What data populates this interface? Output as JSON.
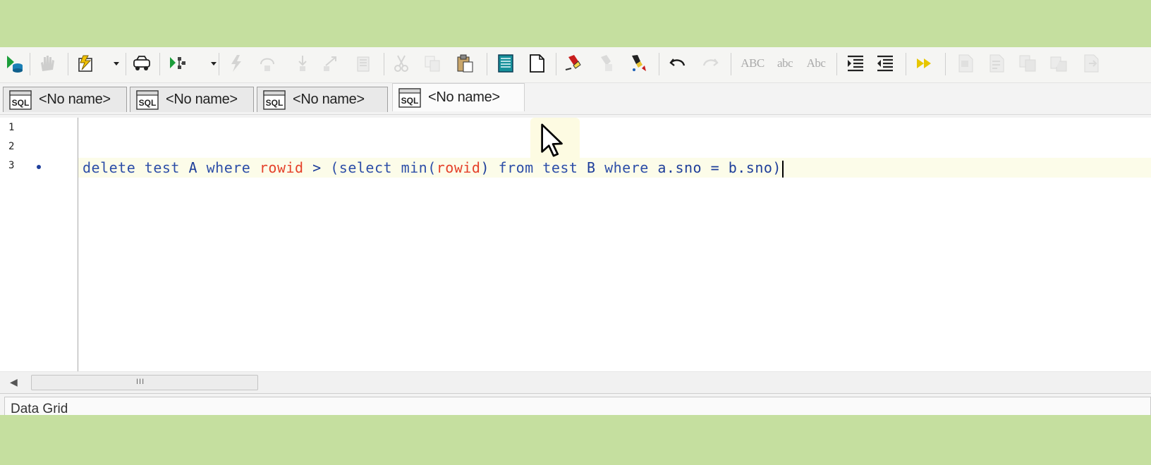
{
  "toolbar": {
    "buttons": [
      {
        "icon": "execute-icon",
        "enabled": true
      },
      {
        "icon": "stop-hand-icon",
        "enabled": false
      },
      {
        "icon": "explain-plan-icon",
        "enabled": true
      },
      {
        "icon": "autotrace-icon",
        "enabled": true
      },
      {
        "icon": "debugger-icon",
        "enabled": true
      },
      {
        "icon": "step-lightning-icon",
        "enabled": false
      },
      {
        "icon": "step-over-icon",
        "enabled": false
      },
      {
        "icon": "step-into-icon",
        "enabled": false
      },
      {
        "icon": "step-out-icon",
        "enabled": false
      },
      {
        "icon": "run-to-cursor-icon",
        "enabled": false
      },
      {
        "icon": "cut-icon",
        "enabled": false
      },
      {
        "icon": "copy-icon",
        "enabled": false
      },
      {
        "icon": "paste-icon",
        "enabled": true
      },
      {
        "icon": "save-document-icon",
        "enabled": true
      },
      {
        "icon": "new-document-icon",
        "enabled": true
      },
      {
        "icon": "highlight-icon",
        "enabled": true
      },
      {
        "icon": "clear-highlight-icon",
        "enabled": false
      },
      {
        "icon": "find-replace-icon",
        "enabled": true
      },
      {
        "icon": "undo-icon",
        "enabled": true
      },
      {
        "icon": "redo-icon",
        "enabled": false
      },
      {
        "icon": "uppercase-icon",
        "enabled": false
      },
      {
        "icon": "lowercase-icon",
        "enabled": false
      },
      {
        "icon": "initcap-icon",
        "enabled": false
      },
      {
        "icon": "indent-icon",
        "enabled": true
      },
      {
        "icon": "unindent-icon",
        "enabled": true
      },
      {
        "icon": "next-bookmark-icon",
        "enabled": true
      },
      {
        "icon": "comment-icon",
        "enabled": false
      },
      {
        "icon": "uncomment-icon",
        "enabled": false
      },
      {
        "icon": "format-icon",
        "enabled": false
      },
      {
        "icon": "copy-block-icon",
        "enabled": false
      },
      {
        "icon": "export-icon",
        "enabled": false
      }
    ],
    "uppercase_text": "ABC",
    "lowercase_text": "abc",
    "initcap_text": "Abc"
  },
  "tabs": [
    {
      "icon": "sql-file-icon",
      "label": "<No name>",
      "active": false
    },
    {
      "icon": "sql-file-icon",
      "label": "<No name>",
      "active": false
    },
    {
      "icon": "sql-file-icon",
      "label": "<No name>",
      "active": false
    },
    {
      "icon": "sql-file-icon",
      "label": "<No name>",
      "active": true
    }
  ],
  "editor": {
    "line_numbers": [
      "1",
      "2",
      "3"
    ],
    "tokens": [
      {
        "t": "delete",
        "c": "kw"
      },
      {
        "t": " ",
        "c": "tx"
      },
      {
        "t": "test",
        "c": "kw"
      },
      {
        "t": " ",
        "c": "tx"
      },
      {
        "t": "A",
        "c": "tx"
      },
      {
        "t": " ",
        "c": "tx"
      },
      {
        "t": "where",
        "c": "kw"
      },
      {
        "t": " ",
        "c": "tx"
      },
      {
        "t": "rowid",
        "c": "fn"
      },
      {
        "t": " ",
        "c": "tx"
      },
      {
        "t": ">",
        "c": "tx"
      },
      {
        "t": " ",
        "c": "tx"
      },
      {
        "t": "(select",
        "c": "kw"
      },
      {
        "t": " ",
        "c": "tx"
      },
      {
        "t": "min(",
        "c": "kw"
      },
      {
        "t": "rowid",
        "c": "fn"
      },
      {
        "t": ")",
        "c": "tx"
      },
      {
        "t": " ",
        "c": "tx"
      },
      {
        "t": "from",
        "c": "kw"
      },
      {
        "t": " ",
        "c": "tx"
      },
      {
        "t": "test",
        "c": "kw"
      },
      {
        "t": " ",
        "c": "tx"
      },
      {
        "t": "B",
        "c": "tx"
      },
      {
        "t": " ",
        "c": "tx"
      },
      {
        "t": "where",
        "c": "kw"
      },
      {
        "t": " ",
        "c": "tx"
      },
      {
        "t": "a.sno",
        "c": "tx"
      },
      {
        "t": " ",
        "c": "tx"
      },
      {
        "t": "=",
        "c": "tx"
      },
      {
        "t": " ",
        "c": "tx"
      },
      {
        "t": "b.sno)",
        "c": "tx"
      }
    ]
  },
  "scrollbar": {
    "grip_text": "III"
  },
  "bottom_panel": {
    "title": "Data Grid"
  },
  "colors": {
    "keyword": "#2d4ea8",
    "function": "#e5412a",
    "text": "#1e3e9a",
    "background": "#c5df9f"
  }
}
